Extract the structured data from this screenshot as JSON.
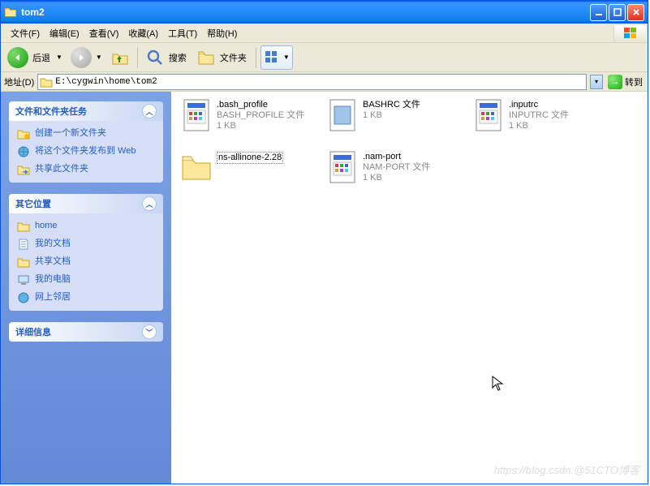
{
  "window": {
    "title": "tom2"
  },
  "menu": {
    "file": "文件(F)",
    "edit": "编辑(E)",
    "view": "查看(V)",
    "fav": "收藏(A)",
    "tools": "工具(T)",
    "help": "帮助(H)"
  },
  "toolbar": {
    "back": "后退",
    "search": "搜索",
    "folders": "文件夹"
  },
  "address": {
    "label": "地址(D)",
    "path": "E:\\cygwin\\home\\tom2",
    "go": "转到"
  },
  "panels": {
    "tasks": {
      "title": "文件和文件夹任务",
      "new_folder": "创建一个新文件夹",
      "publish": "将这个文件夹发布到 Web",
      "share": "共享此文件夹"
    },
    "places": {
      "title": "其它位置",
      "home": "home",
      "mydocs": "我的文档",
      "shared": "共享文档",
      "mycomp": "我的电脑",
      "network": "网上邻居"
    },
    "details": {
      "title": "详细信息"
    }
  },
  "files": [
    {
      "name": ".bash_profile",
      "type": "BASH_PROFILE 文件",
      "size": "1 KB"
    },
    {
      "name": "BASHRC 文件",
      "type": "",
      "size": "1 KB"
    },
    {
      "name": ".inputrc",
      "type": "INPUTRC 文件",
      "size": "1 KB"
    },
    {
      "name": "ns-allinone-2.28",
      "type": "",
      "size": ""
    },
    {
      "name": ".nam-port",
      "type": "NAM-PORT 文件",
      "size": "1 KB"
    }
  ],
  "watermark": "https://blog.csdn.@51CTO博客"
}
